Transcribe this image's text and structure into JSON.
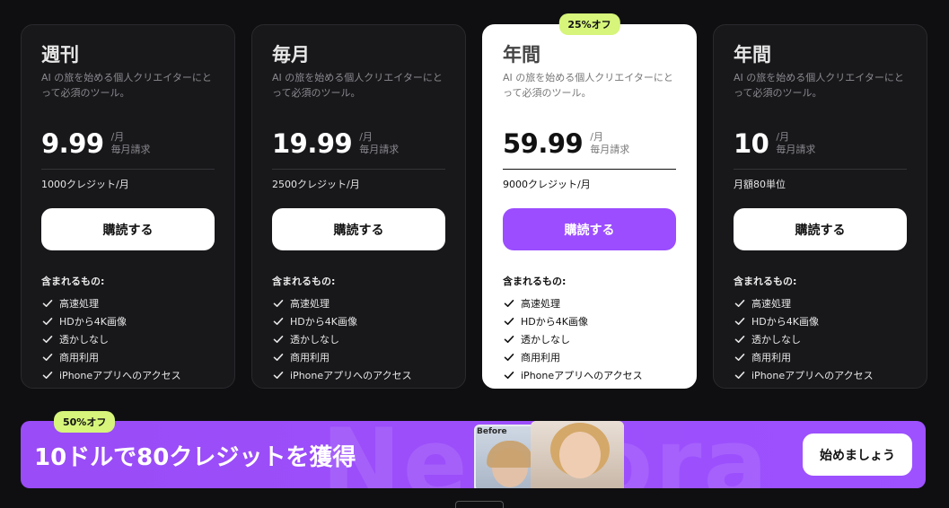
{
  "plans": [
    {
      "name": "週刊",
      "description": "AI の旅を始める個人クリエイターにとって必須のツール。",
      "price": "9.99",
      "per": "/月",
      "billing": "毎月請求",
      "credits": "1000クレジット/月",
      "subscribe_label": "購読する",
      "includes_title": "含まれるもの:",
      "features": [
        "高速処理",
        "HDから4K画像",
        "透かしなし",
        "商用利用",
        "iPhoneアプリへのアクセス"
      ]
    },
    {
      "name": "毎月",
      "description": "AI の旅を始める個人クリエイターにとって必須のツール。",
      "price": "19.99",
      "per": "/月",
      "billing": "毎月請求",
      "credits": "2500クレジット/月",
      "subscribe_label": "購読する",
      "includes_title": "含まれるもの:",
      "features": [
        "高速処理",
        "HDから4K画像",
        "透かしなし",
        "商用利用",
        "iPhoneアプリへのアクセス"
      ]
    },
    {
      "name": "年間",
      "badge": "25%オフ",
      "featured": true,
      "description": "AI の旅を始める個人クリエイターにとって必須のツール。",
      "price": "59.99",
      "per": "/月",
      "billing": "毎月請求",
      "credits": "9000クレジット/月",
      "subscribe_label": "購読する",
      "includes_title": "含まれるもの:",
      "features": [
        "高速処理",
        "HDから4K画像",
        "透かしなし",
        "商用利用",
        "iPhoneアプリへのアクセス"
      ]
    },
    {
      "name": "年間",
      "description": "AI の旅を始める個人クリエイターにとって必須のツール。",
      "price": "10",
      "per": "/月",
      "billing": "毎月請求",
      "credits": "月額80単位",
      "subscribe_label": "購読する",
      "includes_title": "含まれるもの:",
      "features": [
        "高速処理",
        "HDから4K画像",
        "透かしなし",
        "商用利用",
        "iPhoneアプリへのアクセス"
      ]
    }
  ],
  "banner": {
    "badge": "50%オフ",
    "title": "10ドルで80クレジットを獲得",
    "bg_word": "Neurora",
    "before_label": "Before",
    "cta_label": "始めましょう"
  },
  "colors": {
    "accent": "#9b4dff",
    "badge": "#d6f57a",
    "background": "#0f0f11",
    "card": "#18181b"
  },
  "icons": {
    "feature_check": "check-icon"
  }
}
